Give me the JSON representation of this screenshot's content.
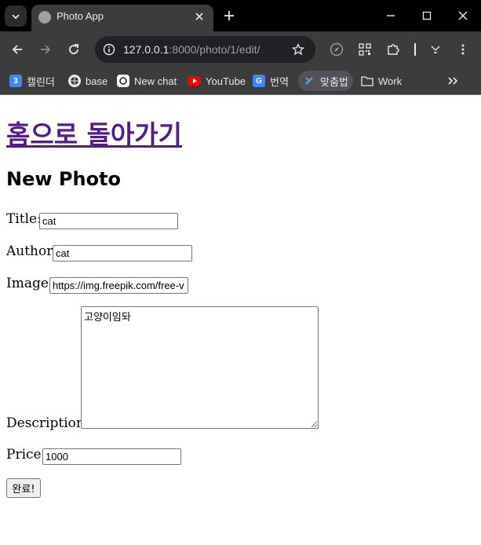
{
  "browser": {
    "tab_title": "Photo App",
    "url_host": "127.0.0.1",
    "url_rest": ":8000/photo/1/edit/",
    "bookmarks": [
      {
        "label": "캘린더",
        "icon": "calendar-icon",
        "badge": "3"
      },
      {
        "label": "base",
        "icon": "globe-icon"
      },
      {
        "label": "New chat",
        "icon": "chatgpt-icon"
      },
      {
        "label": "YouTube",
        "icon": "youtube-icon"
      },
      {
        "label": "번역",
        "icon": "translate-icon"
      },
      {
        "label": "맞춤법",
        "icon": "spellcheck-icon"
      },
      {
        "label": "Work",
        "icon": "folder-icon"
      }
    ],
    "colors": {
      "tabbar_bg": "#000000",
      "toolbar_bg": "#3c3c3c",
      "omnibox_bg": "#202124",
      "text": "#e8eaed"
    }
  },
  "page": {
    "home_link": "홈으로 돌아가기",
    "heading": "New Photo",
    "link_color": "#551a8b",
    "form": {
      "title_label": "Title:",
      "title_value": "cat",
      "author_label": "Author:",
      "author_value": "cat",
      "image_label": "Image:",
      "image_value": "https://img.freepik.com/free-v",
      "description_label": "Description:",
      "description_value": "고양이임돠",
      "price_label": "Price:",
      "price_value": "1000",
      "submit_label": "완료!"
    }
  }
}
